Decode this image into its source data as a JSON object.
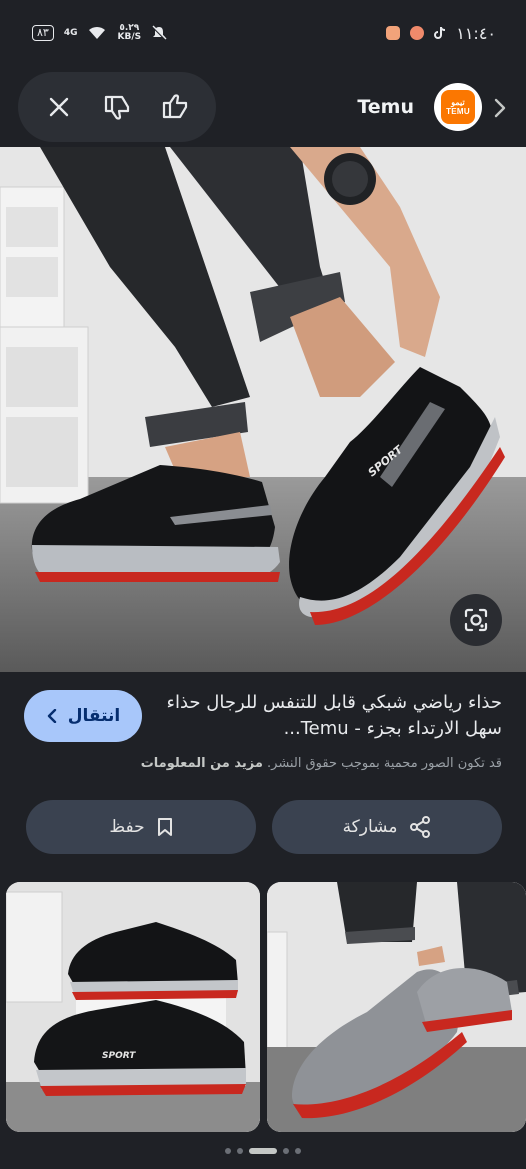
{
  "status_bar": {
    "time": "١١:٤٠",
    "battery": "٨٣",
    "network": "4G",
    "speed_value": "٥.٢٩",
    "speed_unit": "KB/S"
  },
  "header": {
    "source_name": "Temu",
    "logo_text_top": "تيمو",
    "logo_text_bottom": "TEMU"
  },
  "hero": {
    "shoe_logo_text": "SPORT",
    "tongue_text": "SPORT"
  },
  "result": {
    "visit_label": "انتقال",
    "title": "حذاء رياضي شبكي قابل للتنفس للرجال حذاء سهل الارتداء بجزء - Temu...",
    "copyright_text": "قد تكون الصور محمية بموجب حقوق النشر.",
    "more_info": "مزيد من المعلومات"
  },
  "actions": {
    "save_label": "حفظ",
    "share_label": "مشاركة"
  },
  "pager": {
    "count": 5,
    "active": 2
  },
  "colors": {
    "background": "#1f2126",
    "accent": "#a8c7fa",
    "pill": "#3a4250",
    "temu_orange": "#fb7701"
  },
  "icons": [
    "close-icon",
    "thumbs-down-icon",
    "thumbs-up-icon",
    "chevron-right-icon",
    "lens-icon",
    "bookmark-icon",
    "share-icon",
    "chevron-left-icon"
  ]
}
